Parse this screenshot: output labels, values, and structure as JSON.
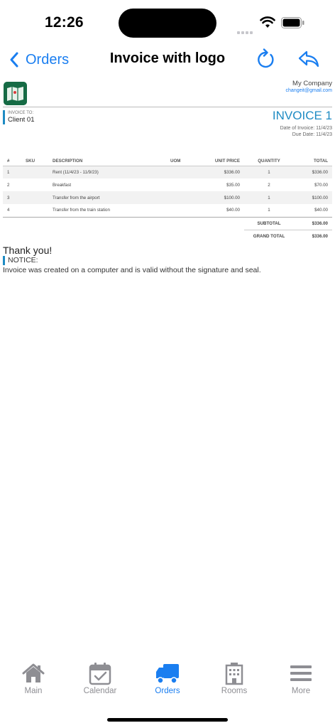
{
  "status_bar": {
    "time": "12:26"
  },
  "nav": {
    "back_label": "Orders",
    "title": "Invoice with logo"
  },
  "invoice": {
    "company_name": "My Company",
    "company_email": "changeit@gmail.com",
    "to_label": "INVOICE TO:",
    "client": "Client 01",
    "title": "INVOICE 1",
    "date_line": "Date of Invoice: 11/4/23",
    "due_line": "Due Date: 11/4/23",
    "columns": [
      "#",
      "SKU",
      "DESCRIPTION",
      "UOM",
      "UNIT PRICE",
      "QUANTITY",
      "TOTAL"
    ],
    "rows": [
      {
        "num": "1",
        "sku": "",
        "desc": "Rent (11/4/23 - 11/9/23)",
        "uom": "",
        "price": "$336.00",
        "qty": "1",
        "total": "$336.00"
      },
      {
        "num": "2",
        "sku": "",
        "desc": "Breakfast",
        "uom": "",
        "price": "$35.00",
        "qty": "2",
        "total": "$70.00"
      },
      {
        "num": "3",
        "sku": "",
        "desc": "Transfer from the airport",
        "uom": "",
        "price": "$100.00",
        "qty": "1",
        "total": "$100.00"
      },
      {
        "num": "4",
        "sku": "",
        "desc": "Transfer from the train station",
        "uom": "",
        "price": "$40.00",
        "qty": "1",
        "total": "$40.00"
      }
    ],
    "subtotal_label": "SUBTOTAL",
    "subtotal": "$336.00",
    "grand_total_label": "GRAND TOTAL",
    "grand_total": "$336.00",
    "thanks": "Thank you!",
    "notice_label": "NOTICE:",
    "notice_text": "Invoice was created on a computer and is valid without the signature and seal."
  },
  "tabs": [
    {
      "label": "Main",
      "icon": "house-icon",
      "active": false
    },
    {
      "label": "Calendar",
      "icon": "calendar-icon",
      "active": false
    },
    {
      "label": "Orders",
      "icon": "truck-icon",
      "active": true
    },
    {
      "label": "Rooms",
      "icon": "building-icon",
      "active": false
    },
    {
      "label": "More",
      "icon": "menu-icon",
      "active": false
    }
  ],
  "colors": {
    "accent": "#1a7ef0",
    "invoice_accent": "#1e8bc3",
    "inactive": "#8e8e93"
  }
}
